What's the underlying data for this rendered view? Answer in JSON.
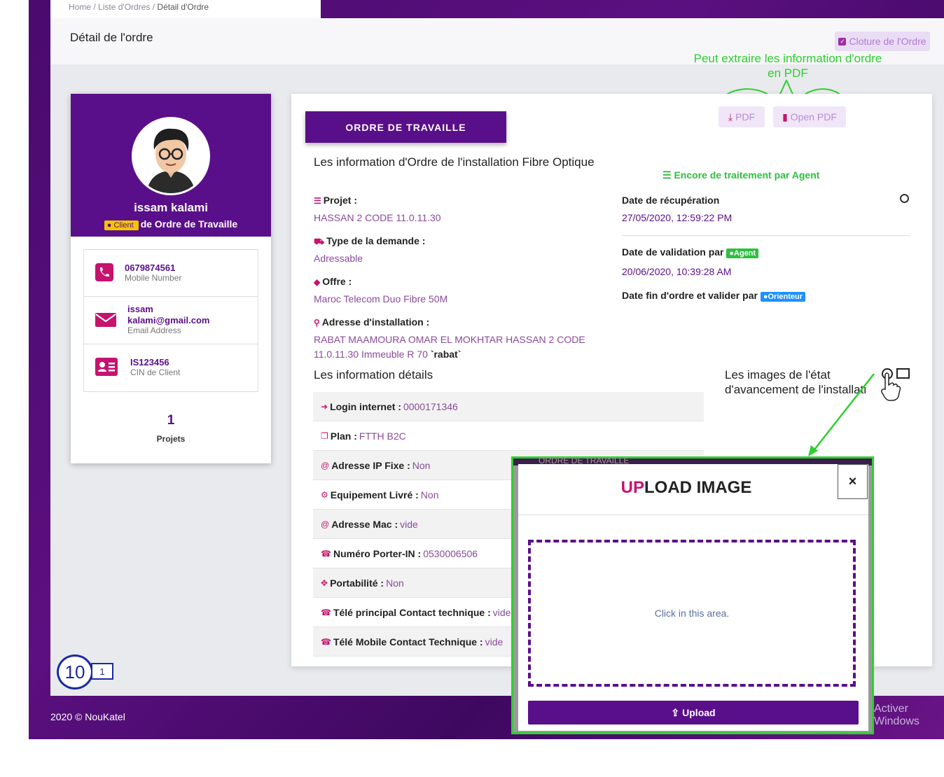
{
  "breadcrumb": {
    "home": "Home",
    "sep1": "/",
    "list": "Liste d'Ordres",
    "sep2": "/",
    "current": "Détail d'Ordre"
  },
  "page_title": "Détail de l'ordre",
  "cloture_button": "Cloture de l'Ordre",
  "annotation_pdf": "Peut extraire les information d'ordre en PDF",
  "profile": {
    "name": "issam kalami",
    "role_badge": "Client",
    "role_text": "de Ordre de Travaille",
    "phone": "0679874561",
    "phone_label": "Mobile Number",
    "email_line1": "issam",
    "email_line2": "kalami@gmail.com",
    "email_label": "Email Address",
    "cin": "IS123456",
    "cin_label": "CIN de Client",
    "projects_count": "1",
    "projects_label": "Projets"
  },
  "order": {
    "tab_label": "ORDRE DE TRAVAILLE",
    "pdf_button": "PDF",
    "open_pdf_button": "Open PDF",
    "section_title": "Les information d'Ordre de l'installation Fibre Optique",
    "status": "Encore de traitement par Agent",
    "projet_label": "Projet :",
    "projet_value": "HASSAN 2 CODE 11.0.11.30",
    "type_label": "Type de la demande :",
    "type_value": "Adressable",
    "offre_label": "Offre :",
    "offre_value": "Maroc Telecom Duo Fibre 50M",
    "adresse_label": "Adresse d'installation :",
    "adresse_value_1": "RABAT MAAMOURA OMAR EL MOKHTAR HASSAN 2 CODE",
    "adresse_value_2": "11.0.11.30 Immeuble R 70",
    "adresse_city": "`rabat`",
    "recup_label": "Date de récupération",
    "recup_value": "27/05/2020, 12:59:22 PM",
    "validation_label": "Date de validation par",
    "agent_badge": "Agent",
    "validation_value": "20/06/2020, 10:39:28 AM",
    "fin_label": "Date fin d'ordre et valider par",
    "orienteur_badge": "Orienteur",
    "details_title": "Les information détails",
    "images_title": "Les images de l'état d'avancement de l'installati",
    "details": [
      {
        "label": "Login internet :",
        "value": "0000171346"
      },
      {
        "label": "Plan :",
        "value": "FTTH B2C"
      },
      {
        "label": "Adresse IP Fixe :",
        "value": "Non"
      },
      {
        "label": "Equipement Livré :",
        "value": "Non"
      },
      {
        "label": "Adresse Mac :",
        "value": "vide"
      },
      {
        "label": "Numéro Porter-IN :",
        "value": "0530006506"
      },
      {
        "label": "Portabilité :",
        "value": "Non"
      },
      {
        "label": "Télé principal Contact technique :",
        "value": "vide"
      },
      {
        "label": "Télé Mobile Contact Technique :",
        "value": "vide"
      }
    ]
  },
  "modal": {
    "title_highlight": "UP",
    "title_rest": "LOAD IMAGE",
    "close": "×",
    "behind_text": "ORDRE DE TRAVAILLE",
    "dropzone_text": "Click in this area.",
    "upload_button": "Upload"
  },
  "footer": {
    "text": "2020 © NouKatel",
    "activer": "Activer Windows"
  },
  "step": {
    "number": "10",
    "sub": "1"
  },
  "colors": {
    "primary": "#5a0f8a",
    "accent": "#c5136e",
    "annotation": "#2fcf2f",
    "step": "#1a2aa0"
  },
  "icons": [
    "check-square-icon",
    "download-icon",
    "file-icon",
    "list-icon",
    "cart-icon",
    "tag-icon",
    "map-marker-icon",
    "clock-icon",
    "user-icon",
    "sign-in-icon",
    "copy-icon",
    "at-icon",
    "cogs-icon",
    "phone-square-icon",
    "arrows-icon",
    "image-icon",
    "upload-icon",
    "hand-pointer-icon",
    "phone-icon",
    "envelope-icon",
    "id-card-icon"
  ]
}
